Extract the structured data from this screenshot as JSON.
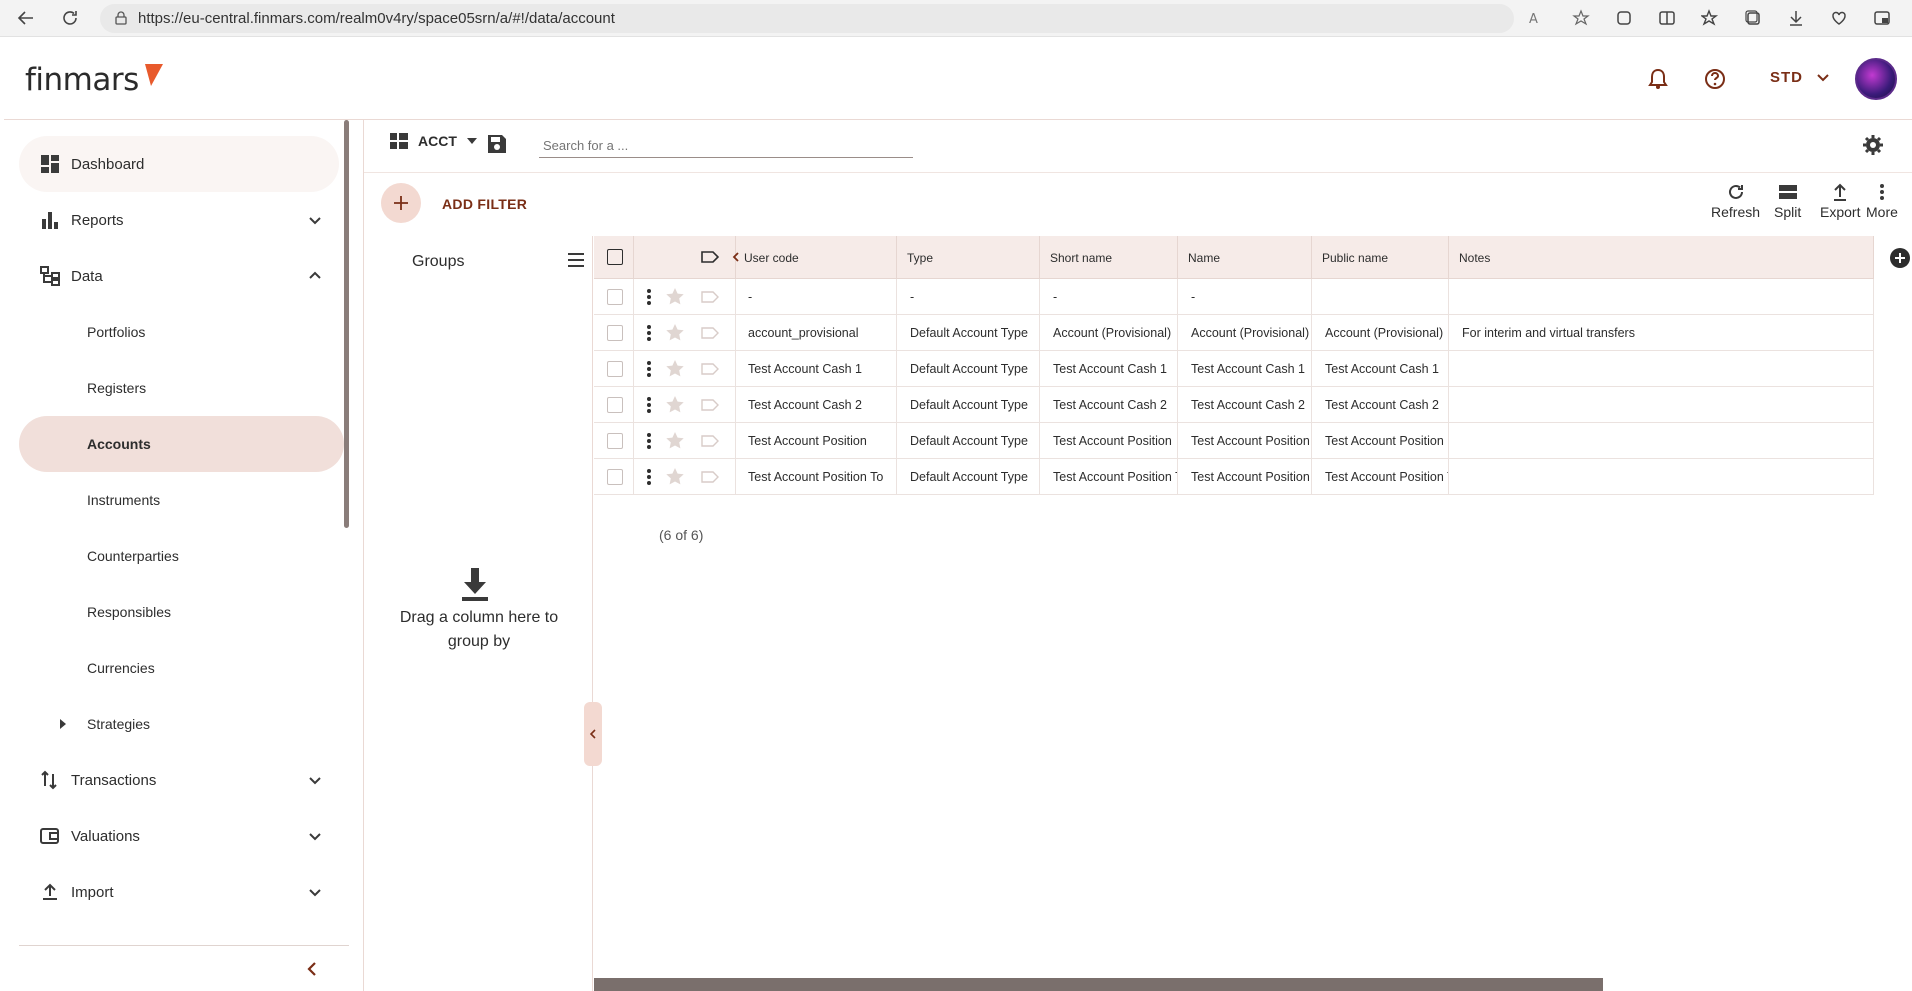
{
  "browser": {
    "url": "https://eu-central.finmars.com/realm0v4ry/space05srn/a/#!/data/account"
  },
  "header": {
    "logo": "finmars",
    "workspace": "STD"
  },
  "sidebar": {
    "items": [
      {
        "label": "Dashboard"
      },
      {
        "label": "Reports"
      },
      {
        "label": "Data"
      },
      {
        "label": "Portfolios"
      },
      {
        "label": "Registers"
      },
      {
        "label": "Accounts"
      },
      {
        "label": "Instruments"
      },
      {
        "label": "Counterparties"
      },
      {
        "label": "Responsibles"
      },
      {
        "label": "Currencies"
      },
      {
        "label": "Strategies"
      },
      {
        "label": "Transactions"
      },
      {
        "label": "Valuations"
      },
      {
        "label": "Import"
      }
    ]
  },
  "toolbar": {
    "layout": "ACCT",
    "search_placeholder": "Search for a ...",
    "add_filter": "ADD FILTER",
    "refresh": "Refresh",
    "split": "Split",
    "export": "Export",
    "more": "More"
  },
  "groups": {
    "title": "Groups",
    "hint": "Drag a column here to group by"
  },
  "table": {
    "columns": [
      "User code",
      "Type",
      "Short name",
      "Name",
      "Public name",
      "Notes"
    ],
    "rows": [
      [
        "-",
        "-",
        "-",
        "-",
        "",
        ""
      ],
      [
        "account_provisional",
        "Default Account Type",
        "Account (Provisional)",
        "Account (Provisional)",
        "Account (Provisional)",
        "For interim and virtual transfers"
      ],
      [
        "Test Account Cash 1",
        "Default Account Type",
        "Test Account Cash 1",
        "Test Account Cash 1",
        "Test Account Cash 1",
        ""
      ],
      [
        "Test Account Cash 2",
        "Default Account Type",
        "Test Account Cash 2",
        "Test Account Cash 2",
        "Test Account Cash 2",
        ""
      ],
      [
        "Test Account Position",
        "Default Account Type",
        "Test Account Position",
        "Test Account Position",
        "Test Account Position",
        ""
      ],
      [
        "Test Account Position To",
        "Default Account Type",
        "Test Account Position Tc",
        "Test Account Position T",
        "Test Account Position Tc",
        ""
      ]
    ],
    "count": "(6 of 6)"
  },
  "colors": {
    "accent": "#7a2e16",
    "accent_light": "#f3d9d1",
    "active_bg": "#f1dfda",
    "header_bg": "#f6ebe8"
  }
}
